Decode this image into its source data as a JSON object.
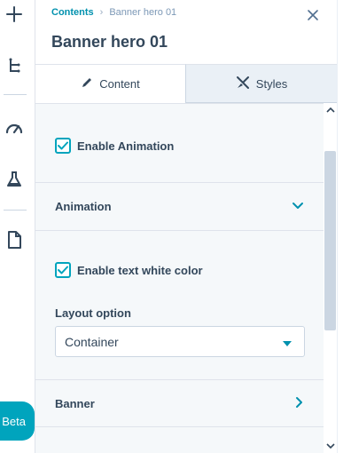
{
  "rail": {
    "icons": [
      "plus-icon",
      "tree-icon",
      "gauge-icon",
      "flask-icon",
      "document-icon"
    ],
    "beta_label": "Beta"
  },
  "breadcrumb": {
    "parent": "Contents",
    "separator": "›",
    "current": "Banner hero 01"
  },
  "panel": {
    "title": "Banner hero 01"
  },
  "tabs": [
    {
      "label": "Content",
      "icon": "pencil-icon",
      "active": true
    },
    {
      "label": "Styles",
      "icon": "brush-icon",
      "active": false
    }
  ],
  "content": {
    "enable_animation": {
      "label": "Enable Animation",
      "checked": true
    },
    "animation_section": {
      "label": "Animation",
      "expanded": true
    },
    "enable_text_white": {
      "label": "Enable text white color",
      "checked": true
    },
    "layout_option": {
      "label": "Layout option",
      "value": "Container"
    },
    "banner_section": {
      "label": "Banner",
      "expanded": false
    }
  },
  "colors": {
    "accent": "#00a4bd",
    "link": "#0091ae",
    "text": "#33475b",
    "panel_bg": "#f5f8fa"
  }
}
